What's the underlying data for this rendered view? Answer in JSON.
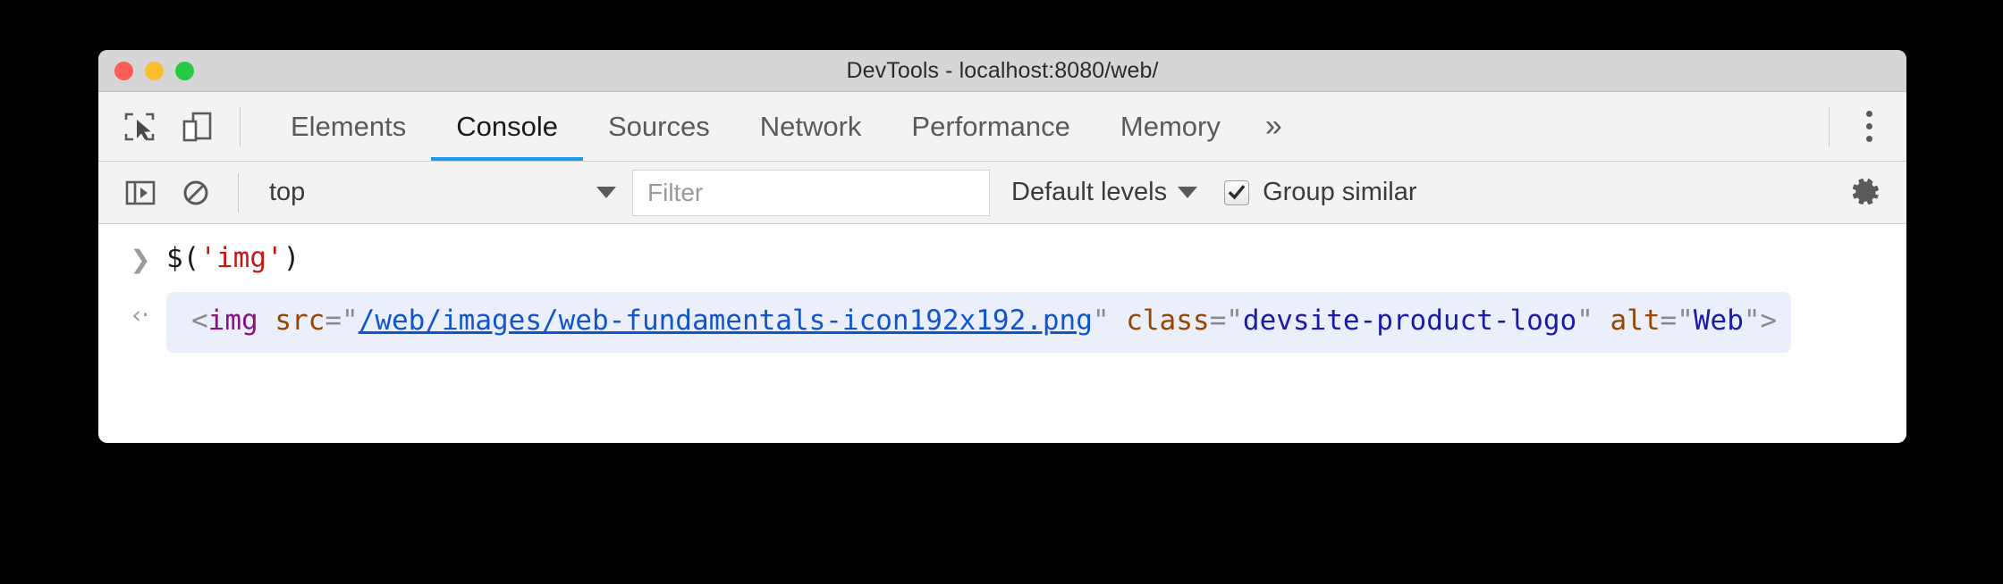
{
  "window": {
    "title": "DevTools - localhost:8080/web/",
    "traffic_lights": [
      {
        "name": "close",
        "color": "#fa5e55"
      },
      {
        "name": "minimize",
        "color": "#fbbd2e"
      },
      {
        "name": "zoom",
        "color": "#26c93f"
      }
    ]
  },
  "tabbar": {
    "inspect_icon": "inspect-element-icon",
    "device_icon": "device-toolbar-icon",
    "tabs": [
      {
        "label": "Elements",
        "active": false
      },
      {
        "label": "Console",
        "active": true
      },
      {
        "label": "Sources",
        "active": false
      },
      {
        "label": "Network",
        "active": false
      },
      {
        "label": "Performance",
        "active": false
      },
      {
        "label": "Memory",
        "active": false
      }
    ],
    "more_tabs_label": "»",
    "menu_icon": "more-options-icon",
    "active_tab_underline_color": "#1a9bf0"
  },
  "console_toolbar": {
    "sidebar_toggle_icon": "console-sidebar-icon",
    "clear_icon": "clear-console-icon",
    "context": "top",
    "filter_placeholder": "Filter",
    "filter_value": "",
    "levels": "Default levels",
    "group_similar_label": "Group similar",
    "group_similar_checked": true,
    "settings_icon": "settings-gear-icon"
  },
  "console": {
    "input_prompt": "❯",
    "input_line": {
      "before": "$(",
      "string": "'img'",
      "after": ")"
    },
    "output_prompt": "‹·",
    "output": {
      "open_bracket": "<",
      "tag": "img",
      "space1": " ",
      "attr1_name": "src",
      "attr1_eq": "=",
      "quote": "\"",
      "attr1_value_link": "/web/images/web-fundamentals-icon192x192.png",
      "space2": " ",
      "attr2_name": "class",
      "attr2_eq": "=",
      "attr2_value": "devsite-product-logo",
      "space3": " ",
      "attr3_name": "alt",
      "attr3_eq": "=",
      "attr3_value": "Web",
      "close_bracket": ">"
    },
    "result_background": "#eaeffb"
  }
}
